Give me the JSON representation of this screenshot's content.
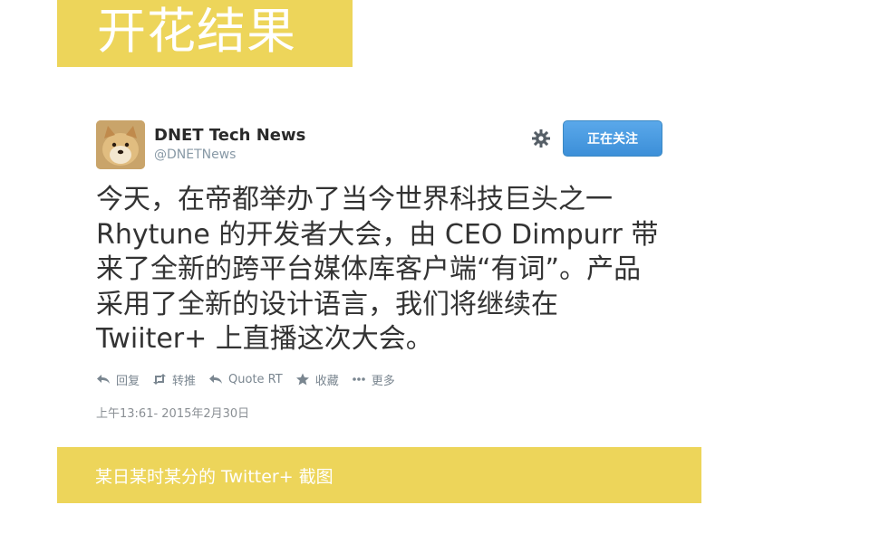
{
  "header": {
    "title": "开花结果"
  },
  "tweet": {
    "display_name": "DNET Tech News",
    "handle": "@DNETNews",
    "follow_label": "正在关注",
    "text": "今天，在帝都举办了当今世界科技巨头之一\nRhytune 的开发者大会，由 CEO Dimpurr 带\n来了全新的跨平台媒体库客户端“有词”。产品\n采用了全新的设计语言，我们将继续在\nTwiiter+ 上直播这次大会。",
    "actions": {
      "reply": "回复",
      "retweet": "转推",
      "quote": "Quote RT",
      "favorite": "收藏",
      "more": "更多"
    },
    "timestamp": "上午13:61- 2015年2月30日"
  },
  "caption": {
    "text": "某日某时某分的 Twitter+ 截图"
  },
  "colors": {
    "banner": "#edd55a",
    "follow_button": "#4a9de0",
    "muted": "#8899a6"
  },
  "icons": [
    "avatar-image",
    "gear-icon",
    "reply-icon",
    "retweet-icon",
    "quote-icon",
    "star-icon",
    "more-icon"
  ]
}
